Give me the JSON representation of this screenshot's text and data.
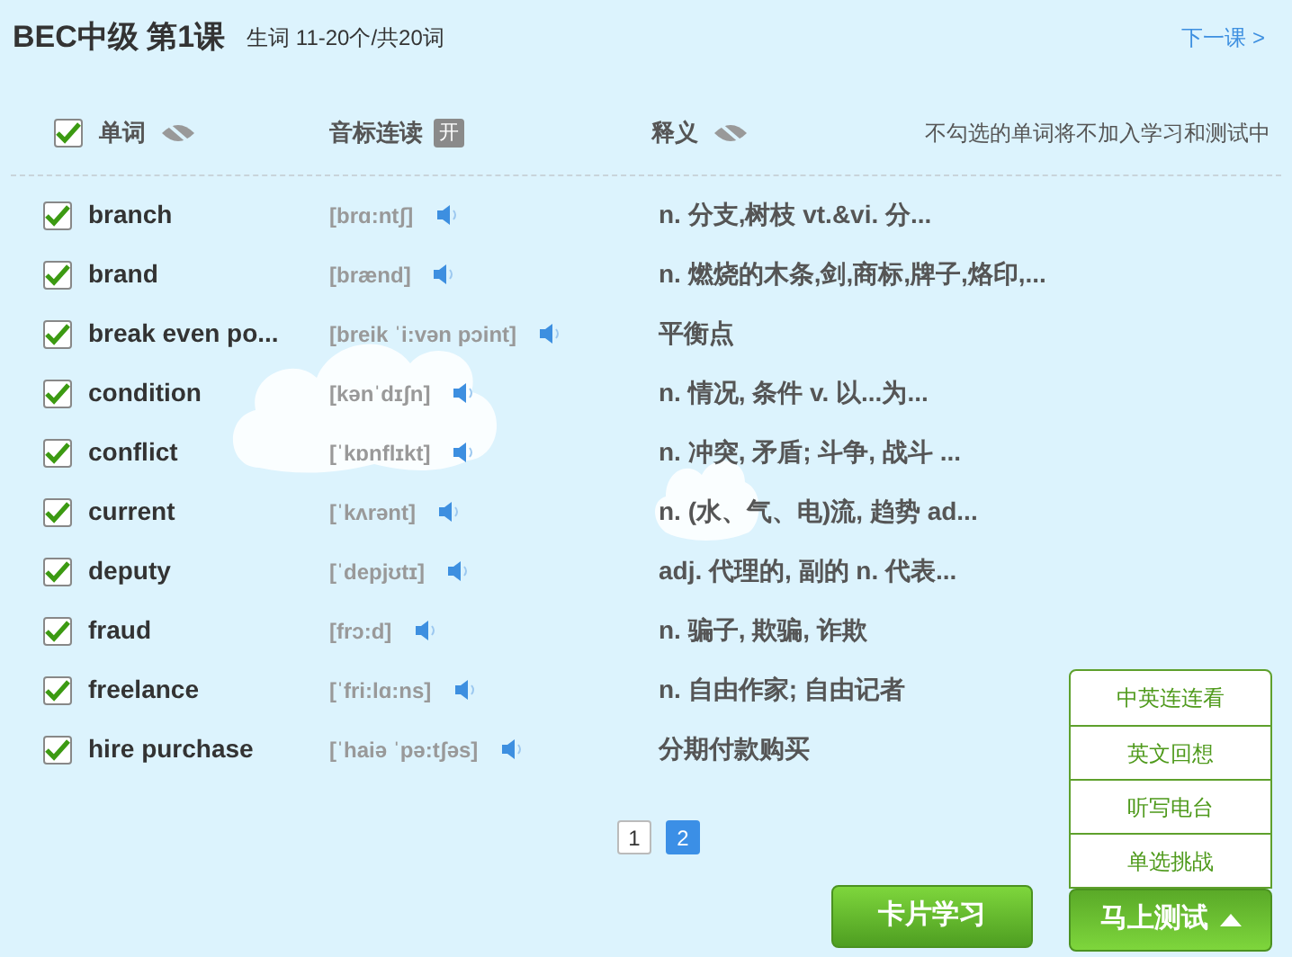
{
  "header": {
    "title": "BEC中级 第1课",
    "subtitle": "生词 11-20个/共20词",
    "next_link": "下一课 >"
  },
  "columns": {
    "select_all_checked": true,
    "word": "单词",
    "phonetic": "音标连读",
    "phonetic_toggle": "开",
    "meaning": "释义",
    "note": "不勾选的单词将不加入学习和测试中"
  },
  "words": [
    {
      "word": "branch",
      "phonetic": "[brɑ:ntʃ]",
      "meaning": "n. 分支,树枝 vt.&vi. 分...",
      "checked": true
    },
    {
      "word": "brand",
      "phonetic": "[brænd]",
      "meaning": "n. 燃烧的木条,剑,商标,牌子,烙印,...",
      "checked": true
    },
    {
      "word": "break even po...",
      "phonetic": "[breik ˈi:vən pɔint]",
      "meaning": "平衡点",
      "checked": true
    },
    {
      "word": "condition",
      "phonetic": "[kənˈdɪʃn]",
      "meaning": "n. 情况, 条件 v. 以...为...",
      "checked": true
    },
    {
      "word": "conflict",
      "phonetic": "[ˈkɒnflɪkt]",
      "meaning": "n. 冲突, 矛盾; 斗争, 战斗 ...",
      "checked": true
    },
    {
      "word": "current",
      "phonetic": "[ˈkʌrənt]",
      "meaning": "n. (水、气、电)流, 趋势 ad...",
      "checked": true
    },
    {
      "word": "deputy",
      "phonetic": "[ˈdepjʊtɪ]",
      "meaning": "adj. 代理的, 副的 n. 代表...",
      "checked": true
    },
    {
      "word": "fraud",
      "phonetic": "[frɔ:d]",
      "meaning": "n. 骗子, 欺骗, 诈欺",
      "checked": true
    },
    {
      "word": "freelance",
      "phonetic": "[ˈfri:lɑ:ns]",
      "meaning": "n. 自由作家; 自由记者",
      "checked": true
    },
    {
      "word": "hire purchase",
      "phonetic": "[ˈhaiə ˈpə:tʃəs]",
      "meaning": "分期付款购买",
      "checked": true
    }
  ],
  "pagination": [
    {
      "label": "1",
      "selected": false
    },
    {
      "label": "2",
      "selected": true
    }
  ],
  "test_menu": {
    "expanded": true,
    "items": [
      "中英连连看",
      "英文回想",
      "听写电台",
      "单选挑战"
    ]
  },
  "buttons": {
    "card_study": "卡片学习",
    "test_now": "马上测试"
  }
}
